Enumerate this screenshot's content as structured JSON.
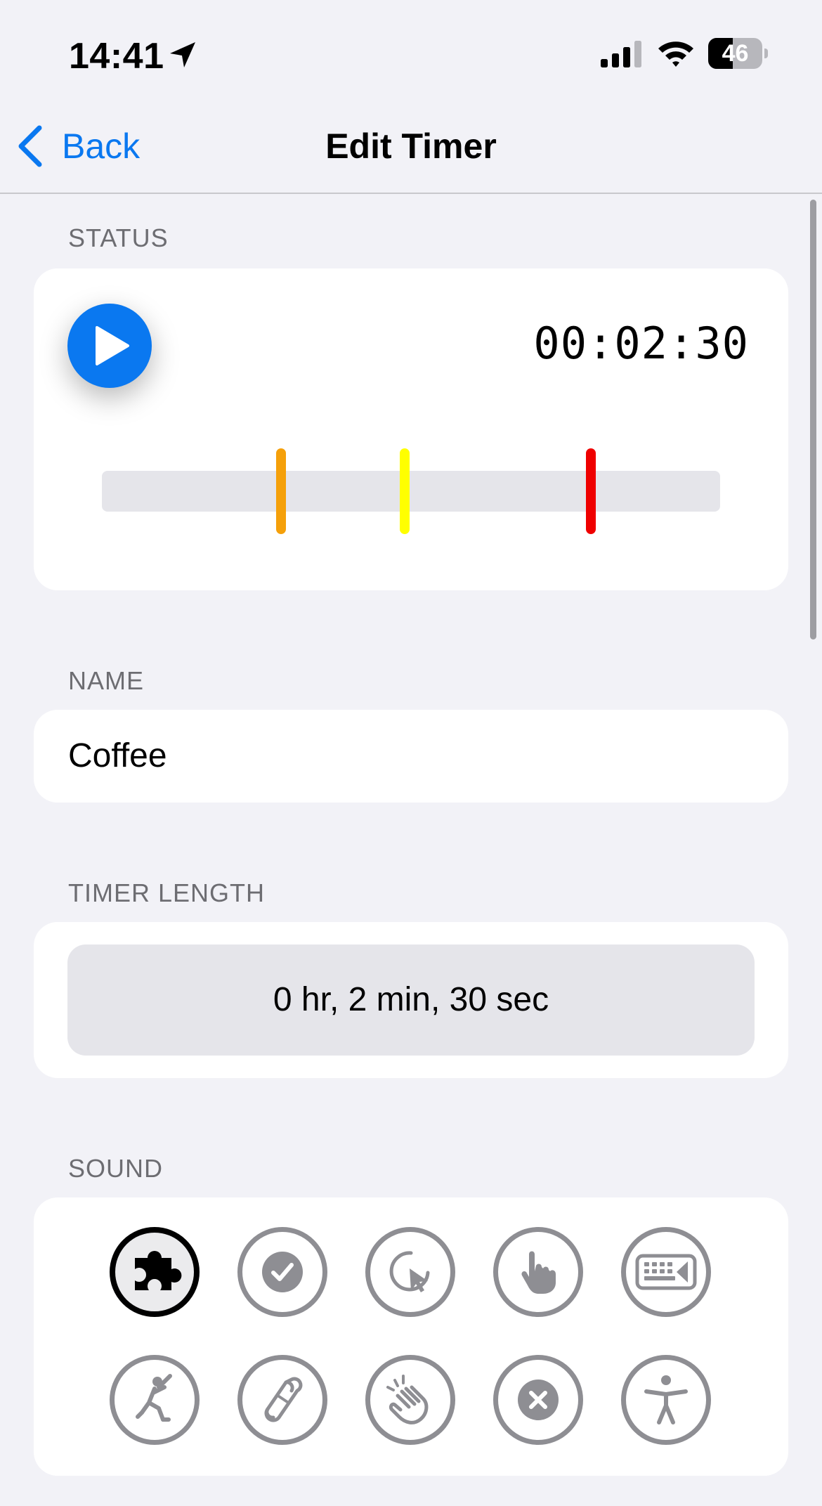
{
  "status_bar": {
    "time": "14:41",
    "battery_level": "46",
    "battery_fraction": 0.46
  },
  "nav": {
    "back_label": "Back",
    "title": "Edit Timer"
  },
  "status_section": {
    "header": "STATUS",
    "countdown": "00:02:30",
    "marker_colors": [
      "#f5a00a",
      "#ffff00",
      "#ef0000"
    ]
  },
  "name_section": {
    "header": "NAME",
    "value": "Coffee"
  },
  "timer_length_section": {
    "header": "TIMER LENGTH",
    "value": "0 hr, 2 min, 30 sec"
  },
  "sound_section": {
    "header": "SOUND",
    "options": [
      {
        "icon": "puzzle-piece-icon",
        "selected": true
      },
      {
        "icon": "checkmark-circle-icon",
        "selected": false
      },
      {
        "icon": "cursor-click-icon",
        "selected": false
      },
      {
        "icon": "pointing-hand-icon",
        "selected": false
      },
      {
        "icon": "keyboard-icon",
        "selected": false
      },
      {
        "icon": "baseball-batter-icon",
        "selected": false
      },
      {
        "icon": "scroll-icon",
        "selected": false
      },
      {
        "icon": "clapping-hands-icon",
        "selected": false
      },
      {
        "icon": "x-circle-icon",
        "selected": false
      },
      {
        "icon": "accessibility-figure-icon",
        "selected": false
      }
    ]
  },
  "colors": {
    "accent": "#0a78f0",
    "background": "#f2f2f7",
    "card": "#ffffff",
    "section_header": "#6d6d72",
    "icon_gray": "#8e8e93"
  }
}
